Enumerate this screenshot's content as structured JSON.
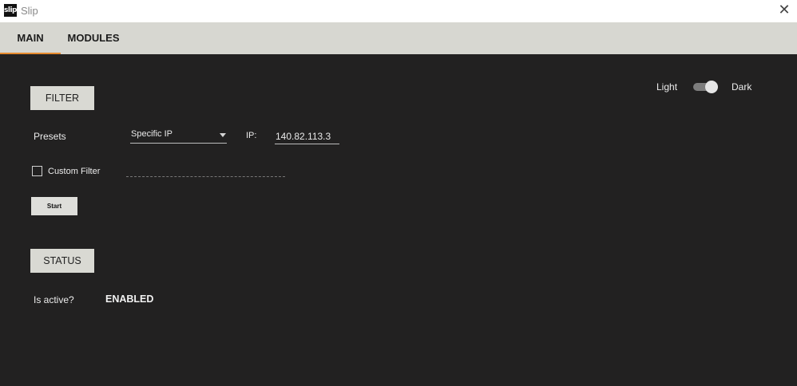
{
  "window": {
    "logo_text": "slip",
    "title": "Slip",
    "close_glyph": "✕"
  },
  "tabs": [
    {
      "label": "MAIN",
      "active": true
    },
    {
      "label": "MODULES",
      "active": false
    }
  ],
  "theme": {
    "light_label": "Light",
    "dark_label": "Dark",
    "is_dark": true
  },
  "filter": {
    "section_label": "FILTER",
    "presets_label": "Presets",
    "preset_value": "Specific IP",
    "ip_label": "IP:",
    "ip_value": "140.82.113.3",
    "custom_filter_label": "Custom Filter",
    "custom_filter_checked": false,
    "custom_filter_value": "",
    "start_label": "Start"
  },
  "status": {
    "section_label": "STATUS",
    "active_label": "Is active?",
    "active_value": "ENABLED"
  },
  "colors": {
    "background": "#222121",
    "tab_bar": "#d7d7d1",
    "accent": "#e58a2e",
    "section_button": "#d9d9d3"
  }
}
